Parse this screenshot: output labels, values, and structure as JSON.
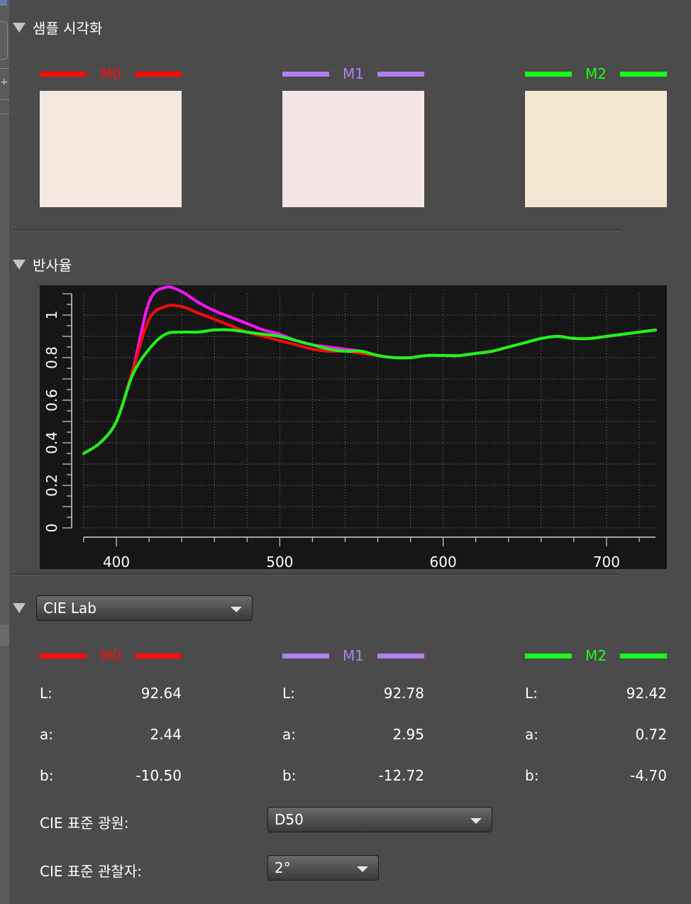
{
  "colors": {
    "m0": "#ff0a0a",
    "m1": "#b07ef0",
    "m2": "#19ff19",
    "m1_line": "#ff14ff",
    "swatch_m0": "#f5e8df",
    "swatch_m1": "#f5e5e5",
    "swatch_m2": "#f5e6d4"
  },
  "sections": {
    "sample": "샘플 시각화",
    "reflectance": "반사율"
  },
  "samples": [
    "M0",
    "M1",
    "M2"
  ],
  "icons": {
    "collapse": "triangle-down-icon",
    "dropdown": "chevron-down-icon"
  },
  "chart_data": {
    "type": "line",
    "xlabel": "",
    "ylabel": "",
    "xlim": [
      380,
      730
    ],
    "ylim": [
      0,
      1.1
    ],
    "x_ticks": [
      400,
      500,
      600,
      700
    ],
    "y_ticks": [
      "0",
      "0.2",
      "0.4",
      "0.6",
      "0.8",
      "1"
    ],
    "grid": true,
    "series": [
      {
        "name": "M0",
        "color_key": "m0",
        "x": [
          380,
          390,
          400,
          410,
          420,
          430,
          440,
          450,
          460,
          470,
          480,
          490,
          500,
          510,
          520,
          530,
          540,
          550,
          560,
          570,
          580,
          590,
          600,
          610,
          620,
          630,
          640,
          650,
          660,
          670,
          680,
          690,
          700,
          710,
          720,
          730
        ],
        "y": [
          0.35,
          0.4,
          0.5,
          0.74,
          0.98,
          1.04,
          1.04,
          1.01,
          0.98,
          0.95,
          0.92,
          0.9,
          0.88,
          0.86,
          0.84,
          0.83,
          0.83,
          0.82,
          0.81,
          0.8,
          0.8,
          0.81,
          0.81,
          0.81,
          0.82,
          0.83,
          0.85,
          0.87,
          0.89,
          0.9,
          0.89,
          0.89,
          0.9,
          0.91,
          0.92,
          0.93
        ]
      },
      {
        "name": "M1",
        "color_key": "m1_line",
        "x": [
          380,
          390,
          400,
          410,
          420,
          430,
          440,
          450,
          460,
          470,
          480,
          490,
          500,
          510,
          520,
          530,
          540,
          550,
          560,
          570,
          580,
          590,
          600,
          610,
          620,
          630,
          640,
          650,
          660,
          670,
          680,
          690,
          700,
          710,
          720,
          730
        ],
        "y": [
          0.35,
          0.4,
          0.5,
          0.74,
          1.06,
          1.13,
          1.11,
          1.06,
          1.02,
          0.99,
          0.96,
          0.93,
          0.91,
          0.88,
          0.86,
          0.85,
          0.84,
          0.83,
          0.81,
          0.8,
          0.8,
          0.81,
          0.81,
          0.81,
          0.82,
          0.83,
          0.85,
          0.87,
          0.89,
          0.9,
          0.89,
          0.89,
          0.9,
          0.91,
          0.92,
          0.93
        ]
      },
      {
        "name": "M2",
        "color_key": "m2",
        "x": [
          380,
          390,
          400,
          410,
          420,
          430,
          440,
          450,
          460,
          470,
          480,
          490,
          500,
          510,
          520,
          530,
          540,
          550,
          560,
          570,
          580,
          590,
          600,
          610,
          620,
          630,
          640,
          650,
          660,
          670,
          680,
          690,
          700,
          710,
          720,
          730
        ],
        "y": [
          0.35,
          0.4,
          0.5,
          0.72,
          0.84,
          0.91,
          0.92,
          0.92,
          0.93,
          0.93,
          0.92,
          0.91,
          0.9,
          0.88,
          0.86,
          0.84,
          0.83,
          0.83,
          0.81,
          0.8,
          0.8,
          0.81,
          0.81,
          0.81,
          0.82,
          0.83,
          0.85,
          0.87,
          0.89,
          0.9,
          0.89,
          0.89,
          0.9,
          0.91,
          0.92,
          0.93
        ]
      }
    ]
  },
  "colorspace": {
    "selected": "CIE Lab"
  },
  "lab": {
    "labels": [
      "L:",
      "a:",
      "b:"
    ],
    "m0": [
      "92.64",
      "2.44",
      "-10.50"
    ],
    "m1": [
      "92.78",
      "2.95",
      "-12.72"
    ],
    "m2": [
      "92.42",
      "0.72",
      "-4.70"
    ]
  },
  "options": {
    "illuminant_label": "CIE 표준 광원:",
    "illuminant_value": "D50",
    "observer_label": "CIE 표준 관찰자:",
    "observer_value": "2°"
  }
}
